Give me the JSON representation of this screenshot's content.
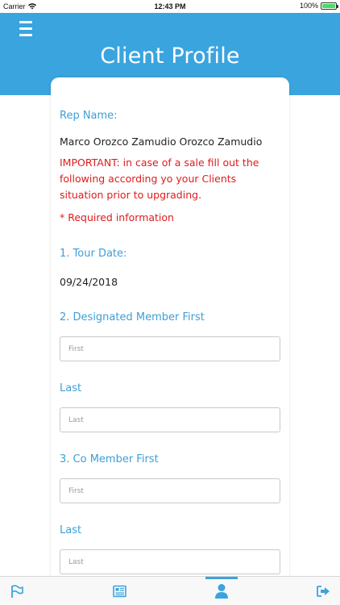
{
  "status_bar": {
    "carrier": "Carrier",
    "time": "12:43 PM",
    "battery": "100%"
  },
  "header": {
    "title": "Client Profile",
    "menu_icon": "hamburger-menu-icon"
  },
  "form": {
    "rep_label": "Rep Name:",
    "rep_name": "Marco Orozco Zamudio Orozco Zamudio",
    "important_text": "IMPORTANT: in case of a sale fill out the following according yo your Clients situation prior to upgrading.",
    "required_text": "* Required information",
    "tour_date_label": "1. Tour Date:",
    "tour_date_value": "09/24/2018",
    "designated_first_label": "2. Designated Member First",
    "designated_first_placeholder": "First",
    "designated_last_label": "Last",
    "designated_last_placeholder": "Last",
    "co_first_label": "3. Co Member First",
    "co_first_placeholder": "First",
    "co_last_label": "Last",
    "co_last_placeholder": "Last"
  },
  "tab_bar": {
    "tabs": [
      {
        "icon": "flag-icon",
        "active": false
      },
      {
        "icon": "newspaper-icon",
        "active": false
      },
      {
        "icon": "person-icon",
        "active": true
      },
      {
        "icon": "logout-icon",
        "active": false
      }
    ]
  },
  "colors": {
    "primary": "#3aa4df",
    "label": "#3d9fd6",
    "warning": "#e01b1b",
    "tab_icon": "#3aa4df"
  }
}
